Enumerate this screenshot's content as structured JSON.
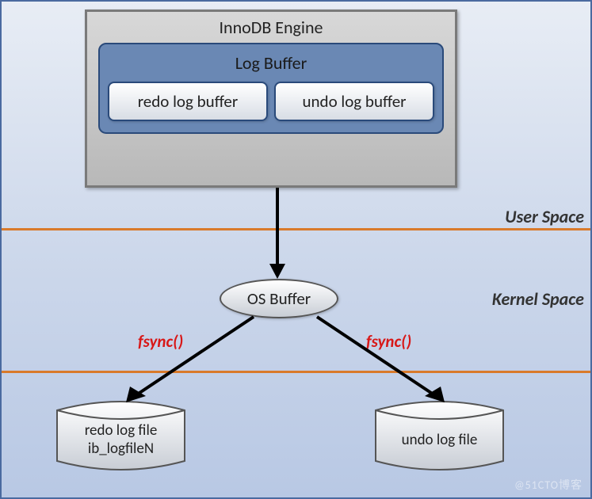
{
  "engine": {
    "title": "InnoDB Engine"
  },
  "log_buffer": {
    "title": "Log Buffer",
    "redo": "redo log buffer",
    "undo": "undo log buffer"
  },
  "regions": {
    "user": "User Space",
    "kernel": "Kernel Space"
  },
  "os_buffer": "OS Buffer",
  "fsync": {
    "left": "fsync()",
    "right": "fsync()"
  },
  "disk": {
    "redo_line1": "redo log file",
    "redo_line2": "ib_logfileN",
    "undo": "undo log file"
  },
  "watermark": "@51CTO博客"
}
